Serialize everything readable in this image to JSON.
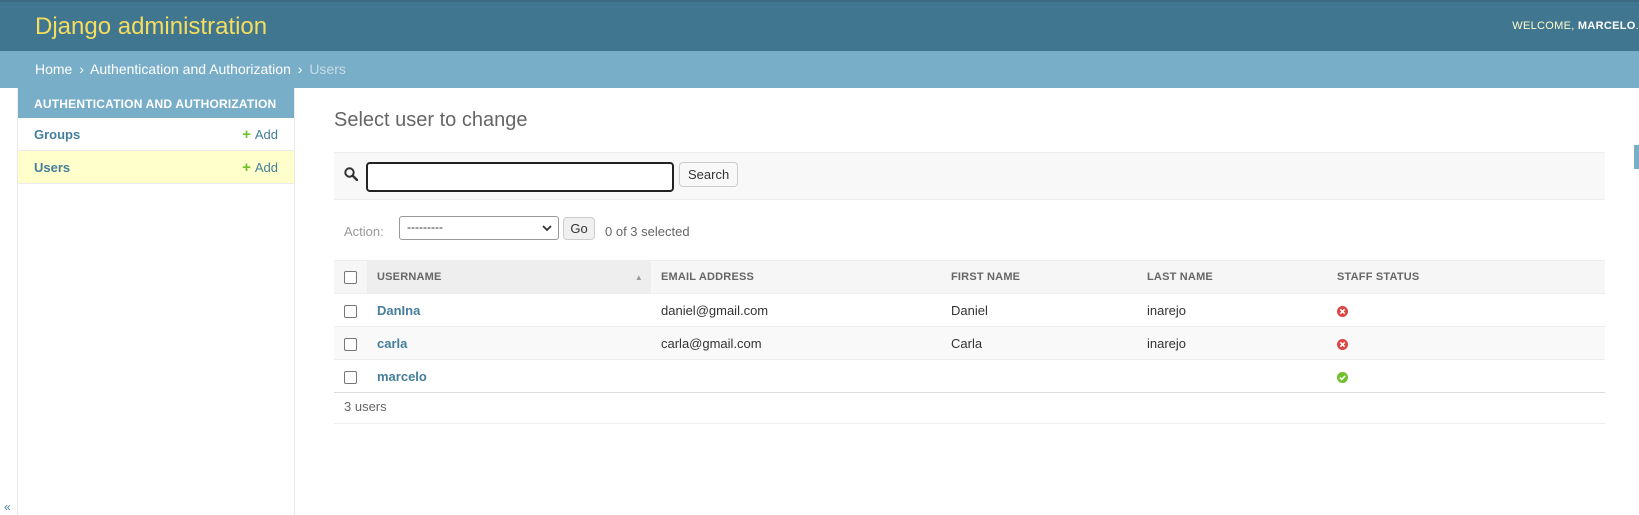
{
  "header": {
    "brand": "Django administration",
    "welcome": "WELCOME, ",
    "username": "MARCELO",
    "trailing": "."
  },
  "breadcrumbs": {
    "home": "Home",
    "app": "Authentication and Authorization",
    "current": "Users",
    "separator": "›"
  },
  "sidebar": {
    "caption": "AUTHENTICATION AND AUTHORIZATION",
    "items": [
      {
        "label": "Groups",
        "add_label": "Add"
      },
      {
        "label": "Users",
        "add_label": "Add"
      }
    ],
    "collapse_glyph": "«"
  },
  "main": {
    "title": "Select user to change",
    "search": {
      "value": "",
      "button": "Search"
    },
    "actions": {
      "label": "Action:",
      "selected_option": "---------",
      "go": "Go",
      "counter": "0 of 3 selected"
    },
    "table": {
      "headers": [
        "USERNAME",
        "EMAIL ADDRESS",
        "FIRST NAME",
        "LAST NAME",
        "STAFF STATUS"
      ],
      "rows": [
        {
          "username": "DanIna",
          "email": "daniel@gmail.com",
          "first_name": "Daniel",
          "last_name": "inarejo",
          "staff": false
        },
        {
          "username": "carla",
          "email": "carla@gmail.com",
          "first_name": "Carla",
          "last_name": "inarejo",
          "staff": false
        },
        {
          "username": "marcelo",
          "email": "",
          "first_name": "",
          "last_name": "",
          "staff": true
        }
      ]
    },
    "paginator": "3 users"
  },
  "colors": {
    "header_bg": "#417690",
    "breadcrumb_bg": "#79aec8",
    "brand_text": "#f5dd5d",
    "link": "#447e9b",
    "add_green": "#70bf2b",
    "staff_no": "#dd4646",
    "staff_yes": "#70bf2b",
    "current_row": "#ffffcc"
  }
}
